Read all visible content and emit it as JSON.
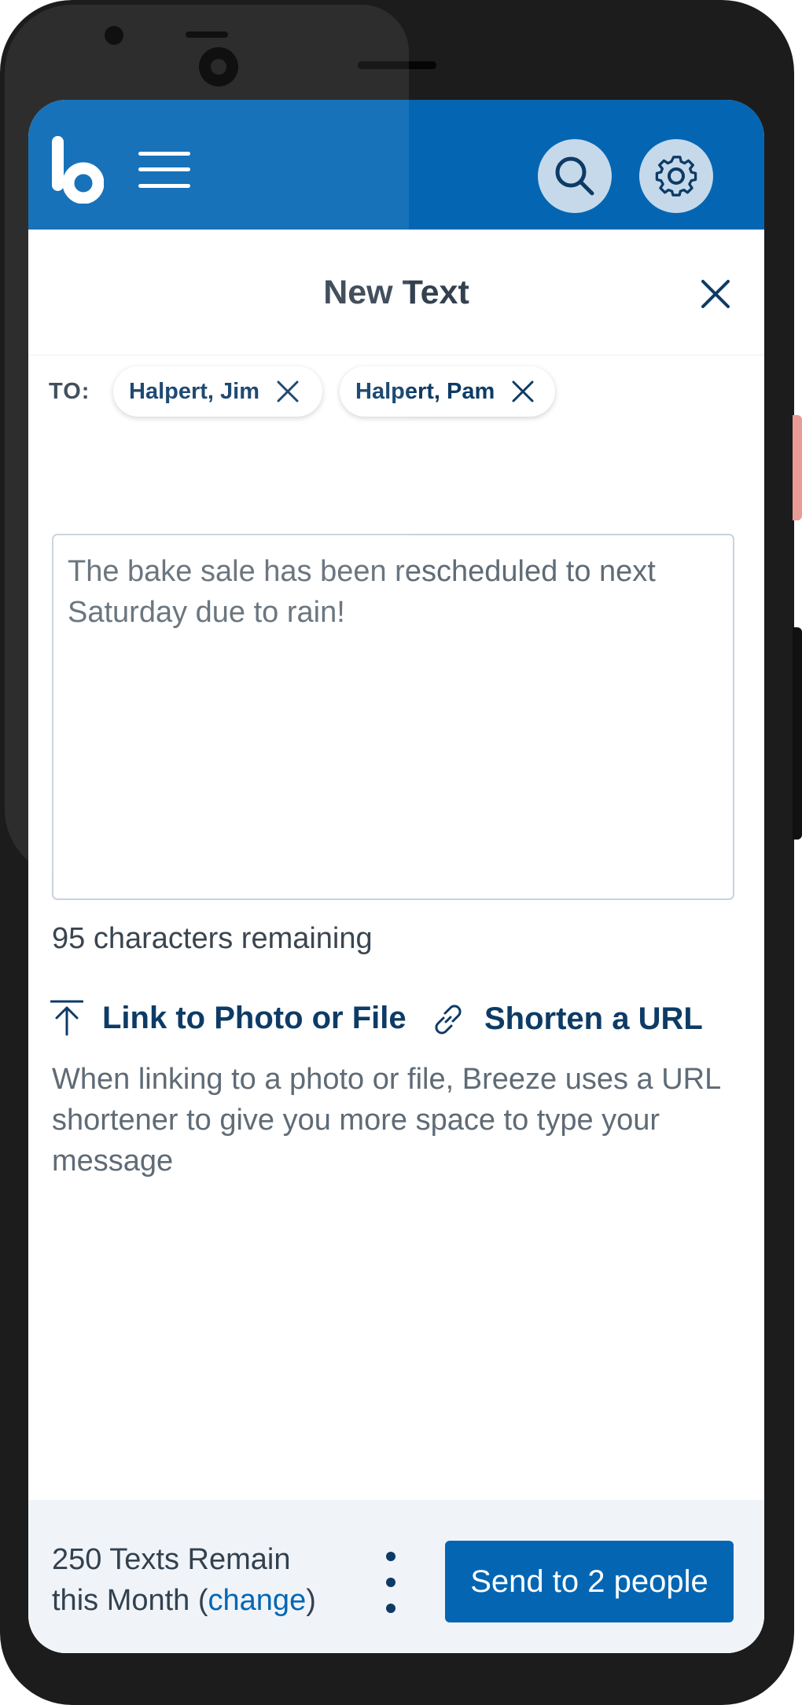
{
  "app": {
    "brand_color": "#0466b3",
    "icons": [
      "breeze-logo-icon",
      "hamburger-menu-icon",
      "search-icon",
      "gear-icon",
      "close-icon",
      "upload-icon",
      "link-icon",
      "more-vertical-icon"
    ]
  },
  "header": {
    "title": "New Text"
  },
  "recipients": {
    "label": "TO:",
    "chips": [
      {
        "name": "Halpert, Jim"
      },
      {
        "name": "Halpert, Pam"
      }
    ]
  },
  "message": {
    "value": "The bake sale has been rescheduled to next Saturday due to rain!",
    "chars_remaining": "95 characters remaining"
  },
  "actions": {
    "link_photo": "Link to Photo or File",
    "shorten_url": "Shorten a URL",
    "help": "When linking to a photo or file, Breeze uses a URL shortener to give you more space to type your message"
  },
  "footer": {
    "line1": "250 Texts Remain",
    "line2_prefix": "this Month (",
    "change_link": "change",
    "line2_suffix": ")",
    "send_label": "Send to 2 people"
  }
}
